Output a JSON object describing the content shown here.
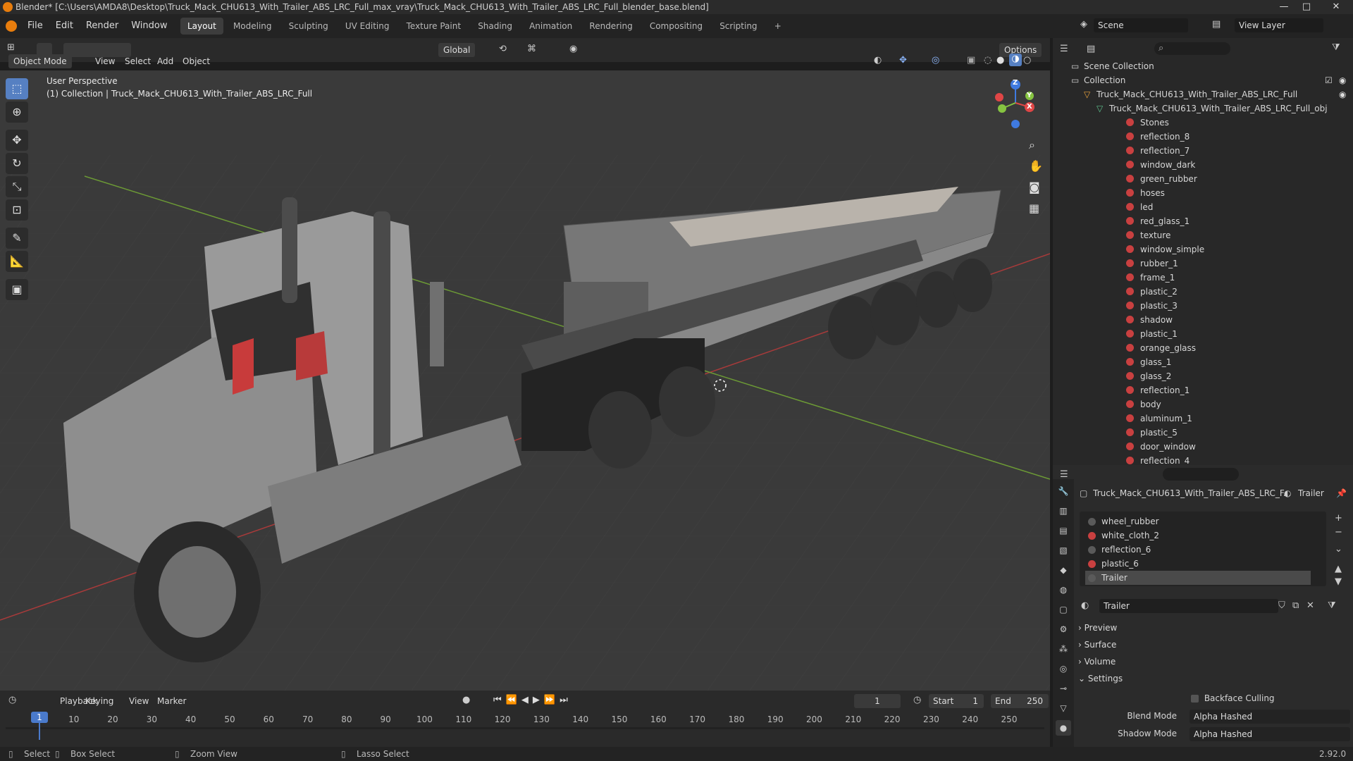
{
  "window": {
    "title": "Blender* [C:\\Users\\AMDA8\\Desktop\\Truck_Mack_CHU613_With_Trailer_ABS_LRC_Full_max_vray\\Truck_Mack_CHU613_With_Trailer_ABS_LRC_Full_blender_base.blend]",
    "minimize": "—",
    "maximize": "□",
    "close": "✕"
  },
  "menubar": {
    "items": [
      "File",
      "Edit",
      "Render",
      "Window",
      "Help"
    ],
    "workspaces": [
      "Layout",
      "Modeling",
      "Sculpting",
      "UV Editing",
      "Texture Paint",
      "Shading",
      "Animation",
      "Rendering",
      "Compositing",
      "Scripting"
    ],
    "add_workspace": "+",
    "scene_label": "Scene",
    "view_layer_label": "View Layer"
  },
  "viewport_header": {
    "mode": "Object Mode",
    "menus": [
      "View",
      "Select",
      "Add",
      "Object"
    ],
    "transform_orientation": "Global",
    "options": "Options"
  },
  "viewport": {
    "overlay_line1": "User Perspective",
    "overlay_line2": "(1) Collection | Truck_Mack_CHU613_With_Trailer_ABS_LRC_Full",
    "gizmo": {
      "z": "Z",
      "y": "Y",
      "x": "X"
    }
  },
  "outliner": {
    "scene_collection": "Scene Collection",
    "collection": "Collection",
    "object": "Truck_Mack_CHU613_With_Trailer_ABS_LRC_Full",
    "mesh": "Truck_Mack_CHU613_With_Trailer_ABS_LRC_Full_obj",
    "materials": [
      "Stones",
      "reflection_8",
      "reflection_7",
      "window_dark",
      "green_rubber",
      "hoses",
      "led",
      "red_glass_1",
      "texture",
      "window_simple",
      "rubber_1",
      "frame_1",
      "plastic_2",
      "plastic_3",
      "shadow",
      "plastic_1",
      "orange_glass",
      "glass_1",
      "glass_2",
      "reflection_1",
      "body",
      "aluminum_1",
      "plastic_5",
      "door_window",
      "reflection_4"
    ]
  },
  "properties": {
    "object_name": "Truck_Mack_CHU613_With_Trailer_ABS_LRC_F...",
    "material_name_header": "Trailer",
    "slots": [
      {
        "name": "wheel_rubber",
        "color": "#5a5a5a"
      },
      {
        "name": "white_cloth_2",
        "color": "#c94040"
      },
      {
        "name": "reflection_6",
        "color": "#5a5a5a"
      },
      {
        "name": "plastic_6",
        "color": "#c94040"
      },
      {
        "name": "Trailer",
        "color": "#5a5a5a"
      }
    ],
    "active_material": "Trailer",
    "sections": [
      "Preview",
      "Surface",
      "Volume",
      "Settings"
    ],
    "backface_culling": "Backface Culling",
    "blend_mode_label": "Blend Mode",
    "blend_mode_value": "Alpha Hashed",
    "shadow_mode_label": "Shadow Mode",
    "shadow_mode_value": "Alpha Hashed",
    "version": "2.92.0"
  },
  "timeline": {
    "menus": [
      "Playback",
      "Keying",
      "View",
      "Marker"
    ],
    "current_frame": "1",
    "start_label": "Start",
    "start_value": "1",
    "end_label": "End",
    "end_value": "250",
    "ruler": [
      "1",
      "10",
      "20",
      "30",
      "40",
      "50",
      "60",
      "70",
      "80",
      "90",
      "100",
      "110",
      "120",
      "130",
      "140",
      "150",
      "160",
      "170",
      "180",
      "190",
      "200",
      "210",
      "220",
      "230",
      "240",
      "250"
    ]
  },
  "statusbar": {
    "select": "Select",
    "box_select": "Box Select",
    "zoom_view": "Zoom View",
    "lasso_select": "Lasso Select"
  },
  "colors": {
    "accent": "#5680c2",
    "orange": "#e87d0d",
    "material_red": "#c94040",
    "axis_red": "#e04646",
    "axis_green": "#86c441",
    "axis_blue": "#3f7ae0"
  }
}
